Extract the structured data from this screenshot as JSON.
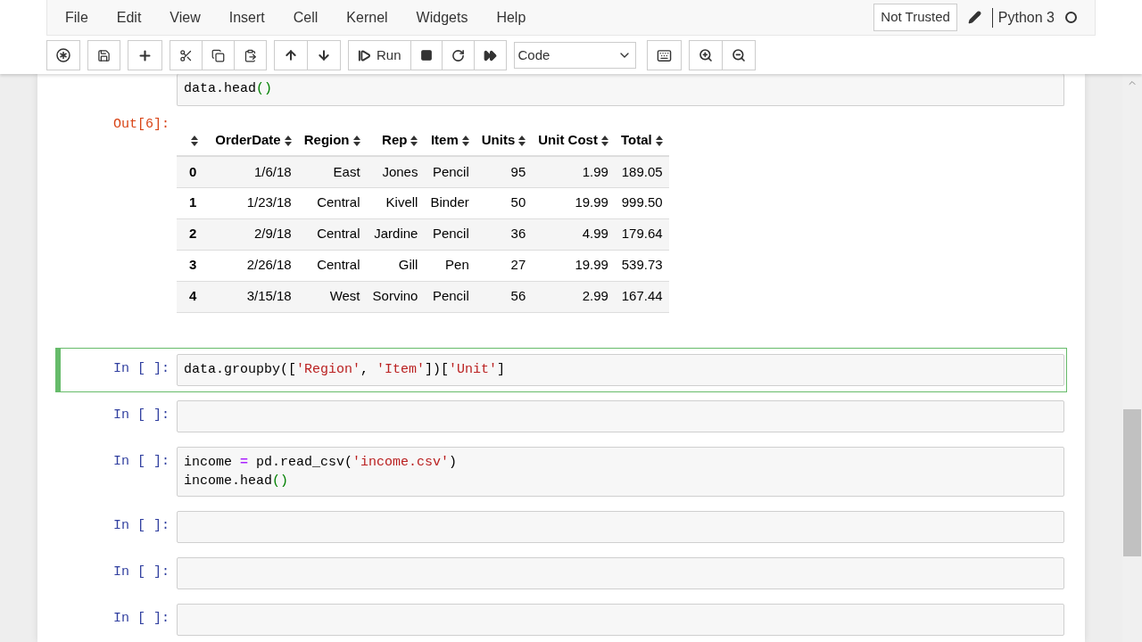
{
  "menu": [
    {
      "label": "File"
    },
    {
      "label": "Edit"
    },
    {
      "label": "View"
    },
    {
      "label": "Insert"
    },
    {
      "label": "Cell"
    },
    {
      "label": "Kernel"
    },
    {
      "label": "Widgets"
    },
    {
      "label": "Help"
    }
  ],
  "trust": "Not Trusted",
  "kernel": {
    "name": "Python 3",
    "busy": false
  },
  "toolbar": {
    "run_label": "Run",
    "cell_type": "Code"
  },
  "cells": [
    {
      "selected": false,
      "lines": [
        [
          {
            "kind": "plain",
            "text": "data.head"
          },
          {
            "kind": "paren",
            "text": "()"
          }
        ]
      ],
      "output": {
        "prompt": "Out[6]:",
        "columns": [
          "OrderDate",
          "Region",
          "Rep",
          "Item",
          "Units",
          "Unit Cost",
          "Total"
        ],
        "rows": [
          {
            "index": "0",
            "cells": [
              "1/6/18",
              "East",
              "Jones",
              "Pencil",
              "95",
              "1.99",
              "189.05"
            ]
          },
          {
            "index": "1",
            "cells": [
              "1/23/18",
              "Central",
              "Kivell",
              "Binder",
              "50",
              "19.99",
              "999.50"
            ]
          },
          {
            "index": "2",
            "cells": [
              "2/9/18",
              "Central",
              "Jardine",
              "Pencil",
              "36",
              "4.99",
              "179.64"
            ]
          },
          {
            "index": "3",
            "cells": [
              "2/26/18",
              "Central",
              "Gill",
              "Pen",
              "27",
              "19.99",
              "539.73"
            ]
          },
          {
            "index": "4",
            "cells": [
              "3/15/18",
              "West",
              "Sorvino",
              "Pencil",
              "56",
              "2.99",
              "167.44"
            ]
          }
        ]
      }
    },
    {
      "prompt": "In [ ]:",
      "selected": true,
      "lines": [
        [
          {
            "kind": "plain",
            "text": "data.groupby(["
          },
          {
            "kind": "string",
            "text": "'Region'"
          },
          {
            "kind": "plain",
            "text": ", "
          },
          {
            "kind": "string",
            "text": "'Item'"
          },
          {
            "kind": "plain",
            "text": "])["
          },
          {
            "kind": "string",
            "text": "'Unit'"
          },
          {
            "kind": "plain",
            "text": "]"
          }
        ]
      ]
    },
    {
      "prompt": "In [ ]:",
      "selected": false
    },
    {
      "prompt": "In [ ]:",
      "selected": false,
      "lines": [
        [
          {
            "kind": "plain",
            "text": "income "
          },
          {
            "kind": "op",
            "text": "="
          },
          {
            "kind": "plain",
            "text": " pd.read_csv("
          },
          {
            "kind": "string",
            "text": "'income.csv'"
          },
          {
            "kind": "plain",
            "text": ")"
          }
        ],
        [
          {
            "kind": "plain",
            "text": "income.head"
          },
          {
            "kind": "paren",
            "text": "()"
          }
        ]
      ]
    },
    {
      "prompt": "In [ ]:",
      "selected": false
    },
    {
      "prompt": "In [ ]:",
      "selected": false
    },
    {
      "prompt": "In [ ]:",
      "selected": false
    }
  ]
}
